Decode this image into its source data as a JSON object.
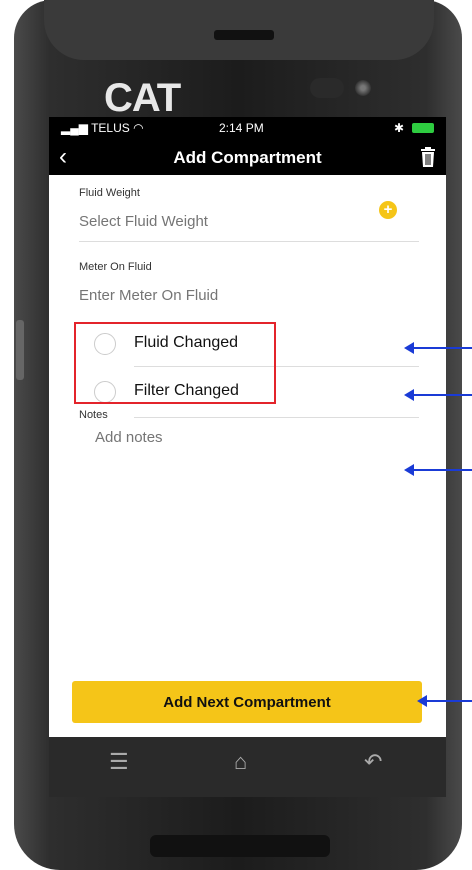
{
  "device": {
    "brand": "CAT"
  },
  "status_bar": {
    "carrier": "TELUS",
    "time": "2:14 PM"
  },
  "nav": {
    "title": "Add Compartment"
  },
  "form": {
    "fluid_weight": {
      "label": "Fluid Weight",
      "placeholder": "Select Fluid Weight"
    },
    "meter_on_fluid": {
      "label": "Meter On Fluid",
      "placeholder": "Enter Meter On Fluid"
    },
    "fluid_changed": {
      "label": "Fluid Changed"
    },
    "filter_changed": {
      "label": "Filter Changed"
    },
    "notes": {
      "label": "Notes",
      "placeholder": "Add notes"
    }
  },
  "actions": {
    "add_next": "Add Next Compartment"
  },
  "colors": {
    "accent": "#f5c518",
    "highlight": "#e3242b",
    "arrow": "#1a3bd6"
  }
}
